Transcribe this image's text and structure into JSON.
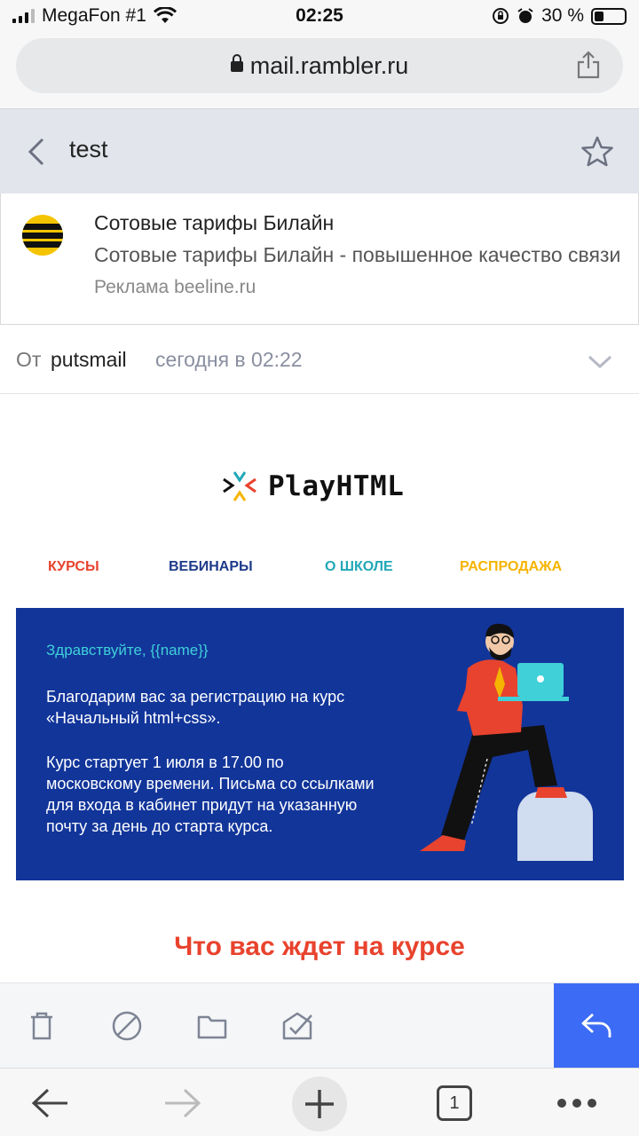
{
  "status_bar": {
    "carrier": "MegaFon #1",
    "time": "02:25",
    "battery": "30 %"
  },
  "browser": {
    "url": "mail.rambler.ru",
    "tab_count": "1"
  },
  "mail": {
    "subject": "test",
    "ad": {
      "title": "Сотовые тарифы Билайн",
      "description": "Сотовые тарифы Билайн - повышенное качество связи",
      "source": "Реклама beeline.ru"
    },
    "from_label": "От",
    "from_name": "putsmail",
    "date": "сегодня в 02:22"
  },
  "email_content": {
    "logo_text": "PlayHTML",
    "menu": [
      "Курсы",
      "Вебинары",
      "О школе",
      "Распродажа"
    ],
    "greeting": "Здравствуйте, {{name}}",
    "paragraph_1": "Благодарим вас за регистрацию на курс «Начальный html+css».",
    "paragraph_2": "Курс стартует 1 июля в 17.00 по московскому времени. Письма со ссылками для входа в кабинет придут на указанную почту за день до старта курса.",
    "section_title": "Что вас ждет на курсе"
  },
  "colors": {
    "banner_bg": "#12359a",
    "accent_red": "#e8432e",
    "reply_button": "#3c6cf5"
  },
  "icons": {
    "toolbar": [
      "trash-icon",
      "block-icon",
      "folder-icon",
      "mark-read-icon",
      "reply-icon"
    ],
    "browser": [
      "back-arrow-icon",
      "forward-arrow-icon",
      "plus-icon",
      "tabs-icon",
      "more-icon"
    ]
  }
}
